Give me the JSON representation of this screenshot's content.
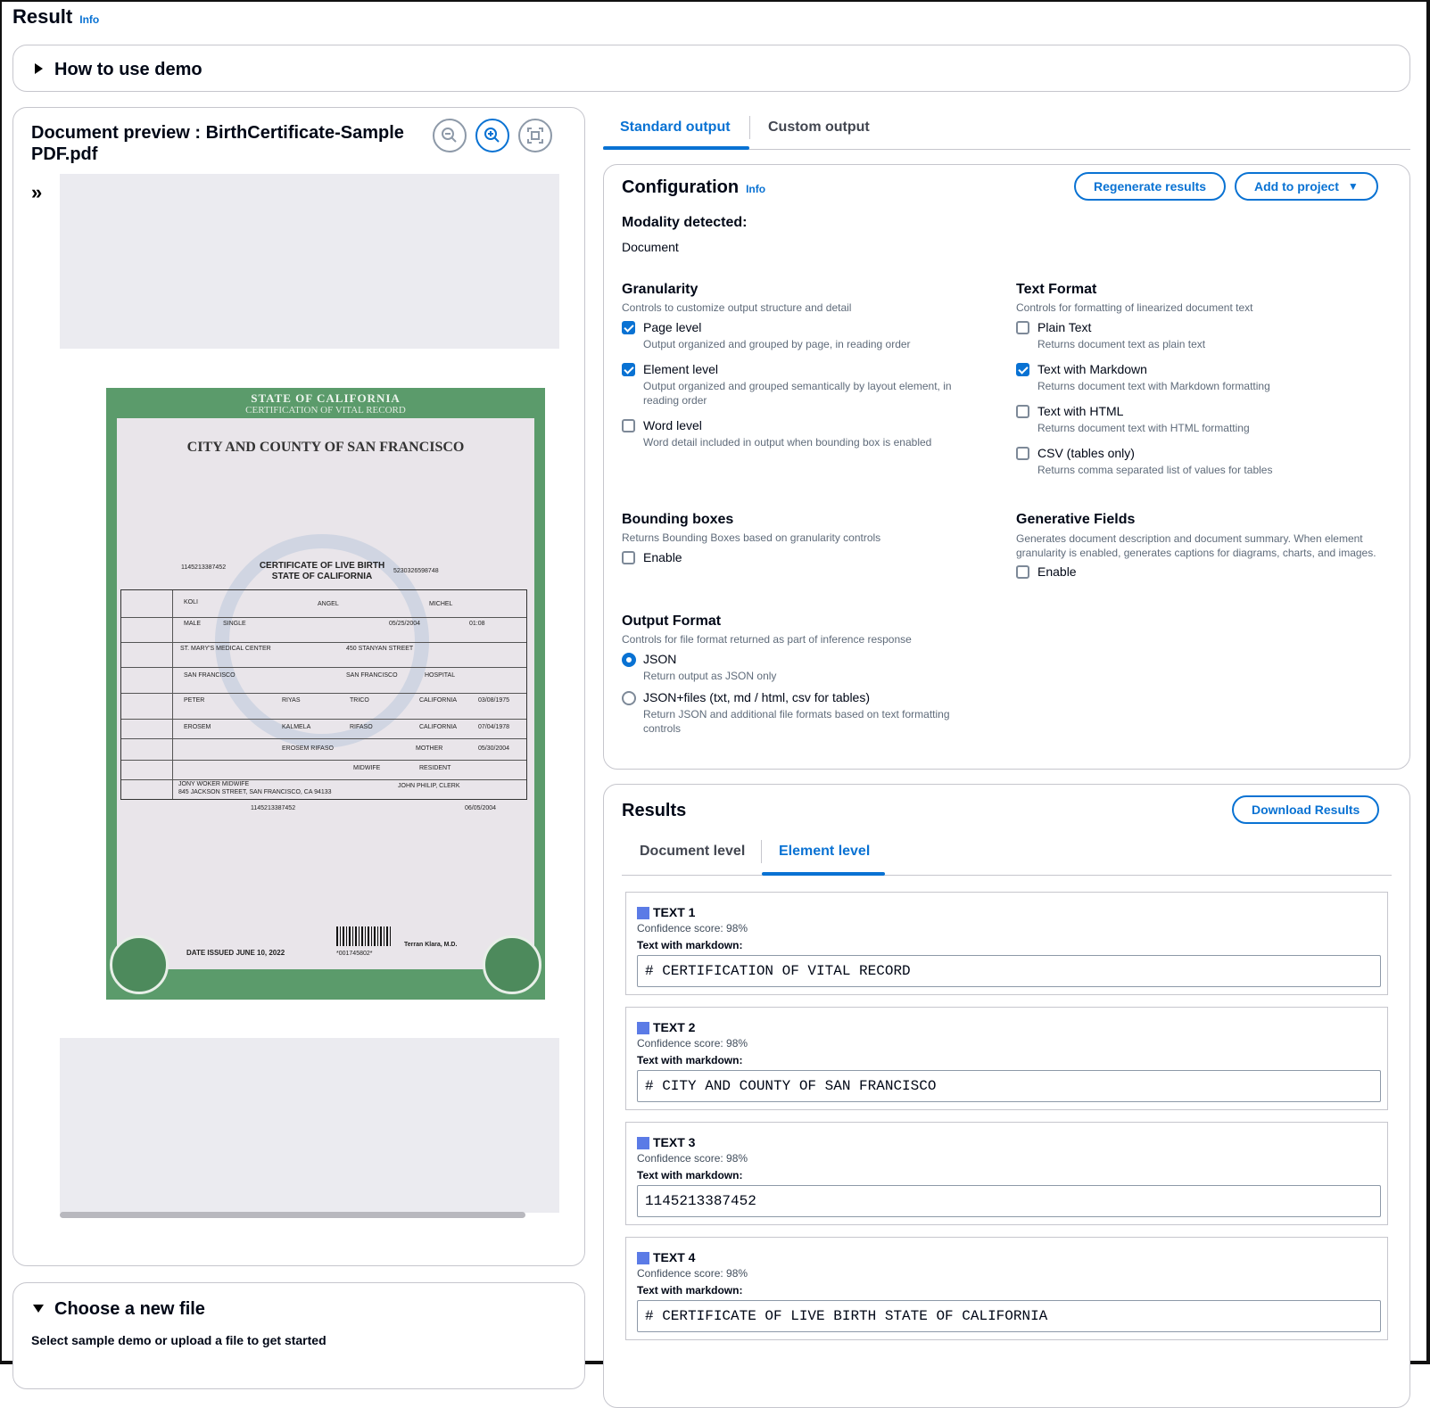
{
  "page": {
    "title": "Result",
    "info": "Info"
  },
  "howto": {
    "label": "How to use demo"
  },
  "preview": {
    "title": "Document preview : BirthCertificate-Sample PDF.pdf",
    "zoom_out": "zoom-out-icon",
    "zoom_in": "zoom-in-icon",
    "fit": "fit-screen-icon",
    "expand_icon": "»",
    "certificate": {
      "header": "STATE OF CALIFORNIA",
      "subheader": "CERTIFICATION OF VITAL RECORD",
      "city": "CITY AND COUNTY OF SAN FRANCISCO",
      "doc_title": "CERTIFICATE OF LIVE BIRTH STATE OF CALIFORNIA",
      "state_file_number": "1145213387452",
      "local_number": "5230326598748",
      "child_first": "KOLI",
      "child_middle": "ANGEL",
      "child_last": "MICHEL",
      "sex": "MALE",
      "birth_type": "SINGLE",
      "dob": "05/25/2004",
      "hour": "01:08",
      "place": "ST. MARY'S MEDICAL CENTER",
      "address": "450 STANYAN STREET",
      "city_name": "SAN FRANCISCO",
      "county": "SAN FRANCISCO",
      "place_type": "HOSPITAL",
      "father_first": "PETER",
      "father_middle": "RIYAS",
      "father_last": "TRICO",
      "father_state": "CALIFORNIA",
      "father_dob": "03/08/1975",
      "mother_first": "EROSEM",
      "mother_middle": "KALMELA",
      "mother_last": "RIFASO",
      "mother_state": "CALIFORNIA",
      "mother_dob": "07/04/1978",
      "informant": "EROSEM RIFASO",
      "relationship": "MOTHER",
      "date_signed": "05/30/2004",
      "attendant": "MIDWIFE",
      "resident": "RESIDENT",
      "attendant_name": "JONY WOKER MIDWIFE",
      "attendant_addr": "845 JACKSON STREET, SAN FRANCISCO, CA 94133",
      "certifier": "JOHN PHILIP, CLERK",
      "registrar_no": "1145213387452",
      "date_accepted": "06/05/2004",
      "date_issued_label": "DATE ISSUED",
      "date_issued": "JUNE 10, 2022",
      "barcode": "*001745802*",
      "officer": "Terran Klara, M.D."
    }
  },
  "choose": {
    "label": "Choose a new file",
    "sub": "Select sample demo or upload a file to get started"
  },
  "tabs": {
    "standard": "Standard output",
    "custom": "Custom output"
  },
  "config": {
    "title": "Configuration",
    "info": "Info",
    "regenerate": "Regenerate results",
    "add_project": "Add to project",
    "modality_label": "Modality detected:",
    "modality_value": "Document",
    "granularity": {
      "title": "Granularity",
      "desc": "Controls to customize output structure and detail",
      "options": [
        {
          "label": "Page level",
          "desc": "Output organized and grouped by page, in reading order",
          "checked": true
        },
        {
          "label": "Element level",
          "desc": "Output organized and grouped semantically by layout element, in reading order",
          "checked": true
        },
        {
          "label": "Word level",
          "desc": "Word detail included in output when bounding box is enabled",
          "checked": false
        }
      ]
    },
    "text_format": {
      "title": "Text Format",
      "desc": "Controls for formatting of linearized document text",
      "options": [
        {
          "label": "Plain Text",
          "desc": "Returns document text as plain text",
          "checked": false
        },
        {
          "label": "Text with Markdown",
          "desc": "Returns document text with Markdown formatting",
          "checked": true
        },
        {
          "label": "Text with HTML",
          "desc": "Returns document text with HTML formatting",
          "checked": false
        },
        {
          "label": "CSV (tables only)",
          "desc": "Returns comma separated list of values for tables",
          "checked": false
        }
      ]
    },
    "bounding": {
      "title": "Bounding boxes",
      "desc": "Returns Bounding Boxes based on granularity controls",
      "enable": "Enable",
      "checked": false
    },
    "generative": {
      "title": "Generative Fields",
      "desc": "Generates document description and document summary. When element granularity is enabled, generates captions for diagrams, charts, and images.",
      "enable": "Enable",
      "checked": false
    },
    "output_format": {
      "title": "Output Format",
      "desc": "Controls for file format returned as part of inference response",
      "options": [
        {
          "label": "JSON",
          "desc": "Return output as JSON only",
          "selected": true
        },
        {
          "label": "JSON+files (txt, md / html, csv for tables)",
          "desc": "Return JSON and additional file formats based on text formatting controls",
          "selected": false
        }
      ]
    }
  },
  "results": {
    "title": "Results",
    "download": "Download Results",
    "tab_document": "Document level",
    "tab_element": "Element level",
    "items": [
      {
        "title": "TEXT 1",
        "score": "Confidence score: 98%",
        "label": "Text with markdown:",
        "value": "# CERTIFICATION OF VITAL RECORD"
      },
      {
        "title": "TEXT 2",
        "score": "Confidence score: 98%",
        "label": "Text with markdown:",
        "value": "# CITY AND COUNTY OF SAN FRANCISCO"
      },
      {
        "title": "TEXT 3",
        "score": "Confidence score: 98%",
        "label": "Text with markdown:",
        "value": "1145213387452"
      },
      {
        "title": "TEXT 4",
        "score": "Confidence score: 98%",
        "label": "Text with markdown:",
        "value": "# CERTIFICATE OF LIVE BIRTH STATE OF CALIFORNIA"
      }
    ]
  },
  "colors": {
    "accent": "#0972d3",
    "marker": "#5b7be6",
    "cert_border": "#5b9b6b"
  }
}
